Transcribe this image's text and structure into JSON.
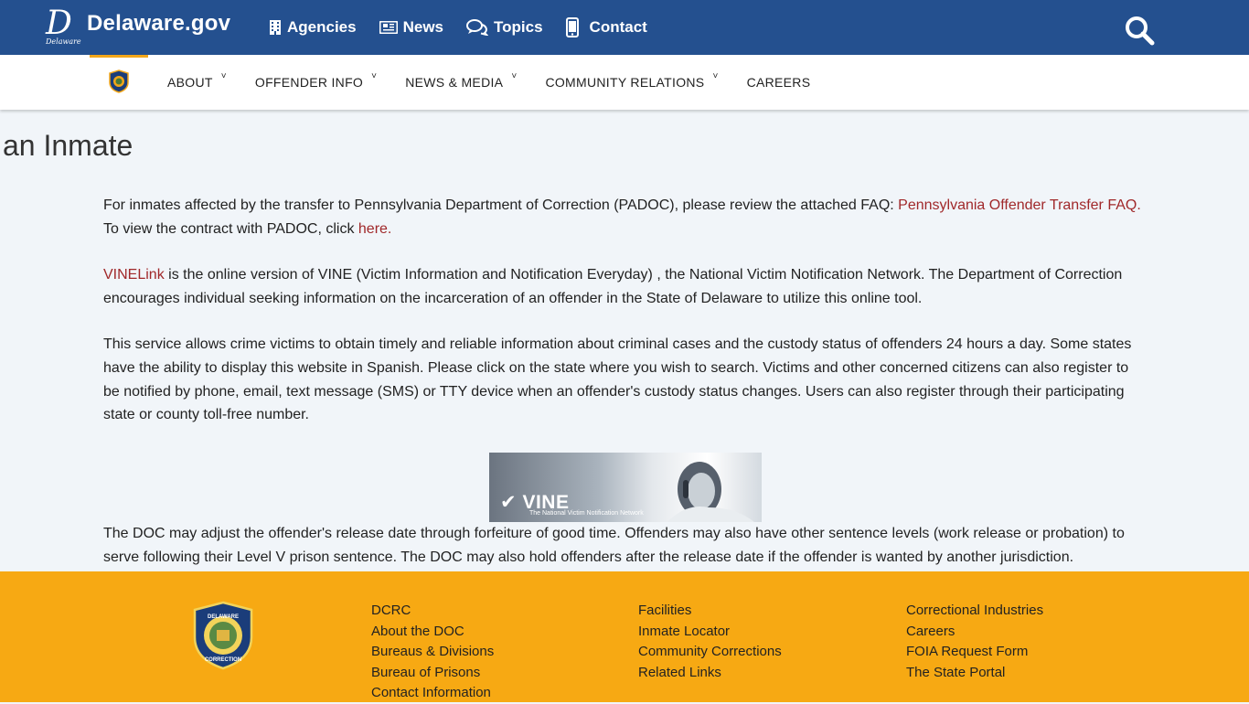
{
  "header": {
    "logo_text": "Delaware.gov",
    "logo_sub": "Delaware",
    "nav": [
      {
        "label": "Agencies",
        "icon": "building-icon"
      },
      {
        "label": "News",
        "icon": "newspaper-icon"
      },
      {
        "label": "Topics",
        "icon": "chat-bubbles-icon"
      },
      {
        "label": "Contact",
        "icon": "phone-icon"
      }
    ],
    "search_icon": "search-icon",
    "colors": {
      "primary": "#24508f",
      "accent": "#f2a619"
    }
  },
  "subnav": {
    "items": [
      {
        "label": "ABOUT",
        "caret": "˅"
      },
      {
        "label": "OFFENDER INFO",
        "caret": "˅"
      },
      {
        "label": "NEWS & MEDIA",
        "caret": "˅"
      },
      {
        "label": "COMMUNITY RELATIONS",
        "caret": "˅"
      },
      {
        "label": "CAREERS",
        "caret": ""
      }
    ]
  },
  "page": {
    "title": "an Inmate",
    "p1_text_a": "For inmates affected by the transfer to Pennsylvania Department of Correction (PADOC), please review the attached FAQ: ",
    "p1_link": "Pennsylvania Offender Transfer FAQ.",
    "p1_text_b": " To view the contract with PADOC, click ",
    "p1_link2": "here.",
    "p2_link": "VINELink",
    "p2_text": " is the online version of VINE (Victim Information and Notification Everyday) , the National Victim Notification Network. The Department of Correction encourages individual seeking information on the incarceration of an offender in the State of Delaware to utilize this online tool.",
    "p3_text": "This service allows crime victims to obtain timely and reliable information about criminal cases and the custody status of offenders 24 hours a day. Some states have the ability to display this website in Spanish. Please click on the state where you wish to search. Victims and other concerned citizens can also register to be notified by phone, email, text message (SMS) or TTY device when an offender's custody status changes. Users can also register through their participating state or county toll-free number.",
    "vine_logo": "VINE",
    "vine_tag": "The National Victim Notification Network",
    "p4_text": "The DOC may adjust the offender's release date through forfeiture of good time. Offenders may also have other sentence levels (work release or probation) to serve following their Level V prison sentence. The DOC may also hold offenders after the release date if the offender is wanted by another jurisdiction."
  },
  "footer": {
    "col1": [
      "DCRC",
      "About the DOC",
      "Bureaus & Divisions",
      "Bureau of Prisons",
      "Contact Information"
    ],
    "col2": [
      "Facilities",
      "Inmate Locator",
      "Community Corrections",
      "Related Links"
    ],
    "col3": [
      "Correctional Industries",
      "Careers",
      "FOIA Request Form",
      "The State Portal"
    ],
    "seal_top": "DELAWARE",
    "seal_bottom": "CORRECTION",
    "color": "#f7a913"
  }
}
